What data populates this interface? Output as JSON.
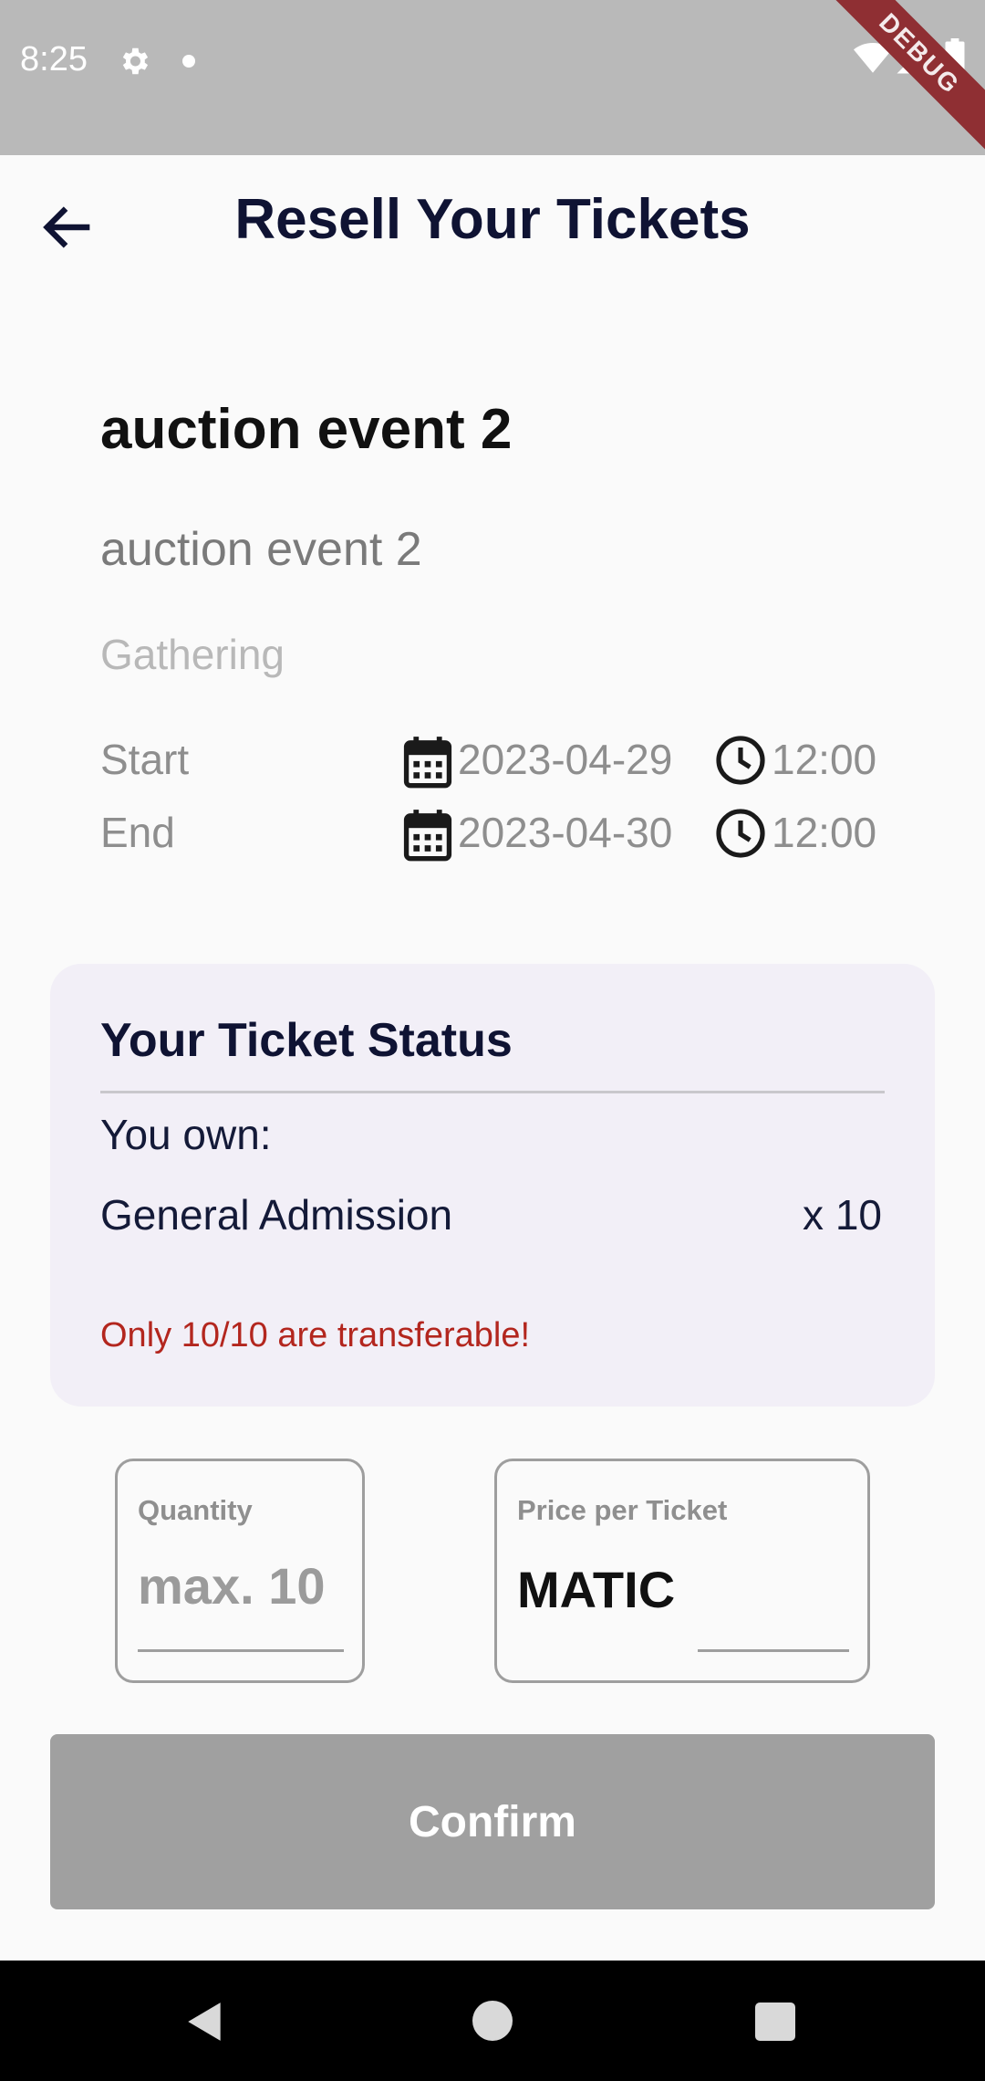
{
  "status_bar": {
    "time": "8:25",
    "icons": [
      "gear-icon",
      "notification-dot-icon",
      "wifi-icon",
      "signal-icon",
      "battery-icon"
    ],
    "debug_banner": "DEBUG"
  },
  "app_bar": {
    "back_icon": "arrow-back-icon",
    "title": "Resell Your Tickets"
  },
  "event": {
    "name": "auction event 2",
    "description": "auction event 2",
    "category": "Gathering",
    "start": {
      "label": "Start",
      "date": "2023-04-29",
      "time": "12:00"
    },
    "end": {
      "label": "End",
      "date": "2023-04-30",
      "time": "12:00"
    }
  },
  "ticket_status": {
    "title": "Your Ticket Status",
    "own_label": "You own:",
    "tickets": [
      {
        "name": "General Admission",
        "quantity": "x 10"
      }
    ],
    "warning": "Only 10/10 are transferable!"
  },
  "form": {
    "quantity": {
      "label": "Quantity",
      "placeholder": "max. 10",
      "value": ""
    },
    "price": {
      "label": "Price per Ticket",
      "currency": "MATIC",
      "value": ""
    }
  },
  "confirm_label": "Confirm",
  "colors": {
    "title": "#0f1333",
    "card_background": "#f2eff7",
    "warning": "#b3261e",
    "button_disabled": "#a0a0a0",
    "status_bar": "#b9b9b9",
    "debug_banner": "#8f2f33"
  }
}
